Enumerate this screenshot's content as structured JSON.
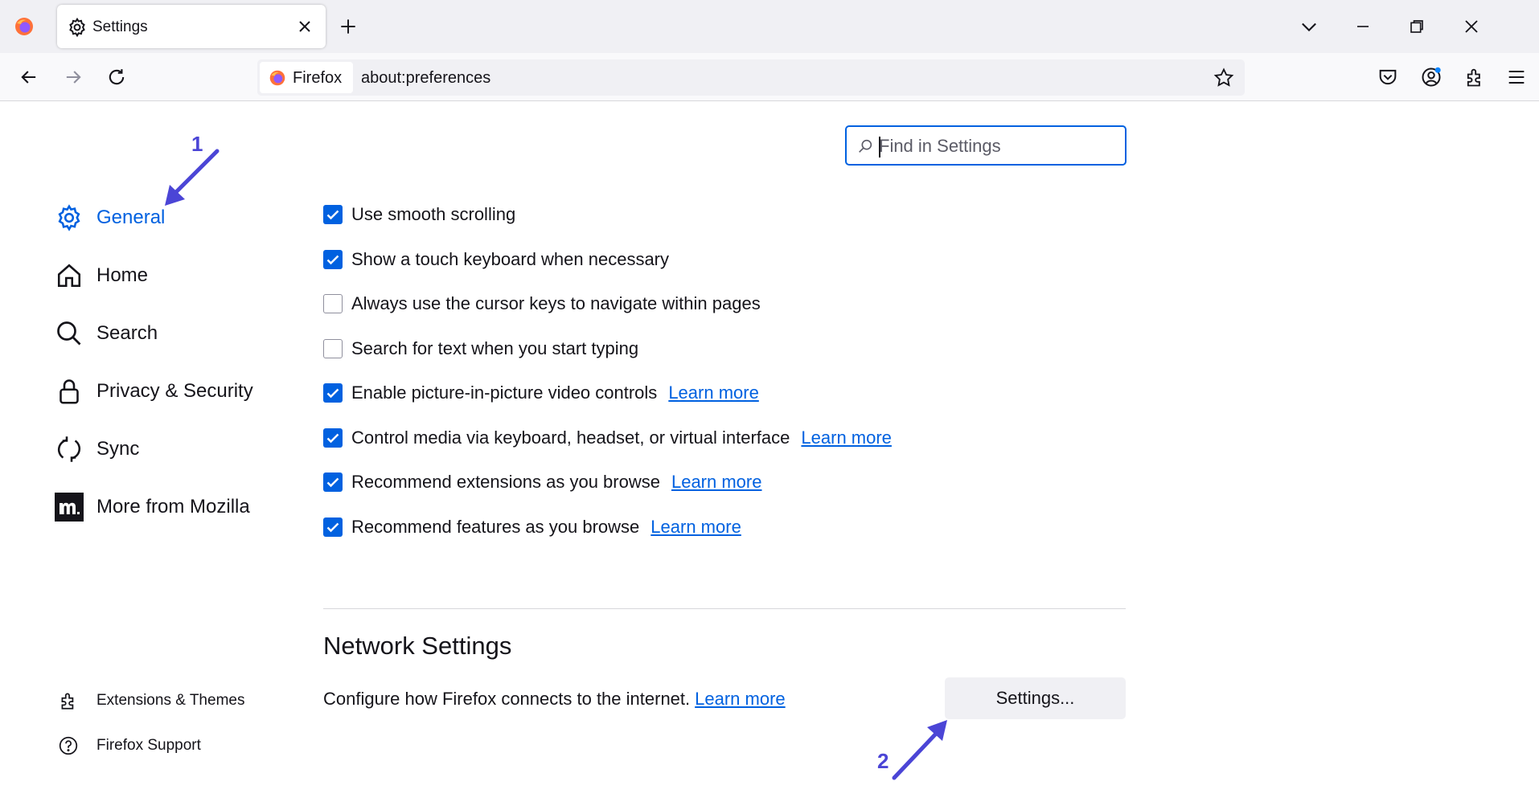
{
  "tab": {
    "title": "Settings"
  },
  "urlbar": {
    "identity_label": "Firefox",
    "url": "about:preferences"
  },
  "search": {
    "placeholder": "Find in Settings"
  },
  "sidebar": {
    "categories": [
      {
        "label": "General",
        "icon": "gear-icon",
        "selected": true
      },
      {
        "label": "Home",
        "icon": "home-icon"
      },
      {
        "label": "Search",
        "icon": "search-icon"
      },
      {
        "label": "Privacy & Security",
        "icon": "lock-icon"
      },
      {
        "label": "Sync",
        "icon": "sync-icon"
      },
      {
        "label": "More from Mozilla",
        "icon": "mozilla-m-icon"
      }
    ],
    "footer": [
      {
        "label": "Extensions & Themes",
        "icon": "puzzle-icon"
      },
      {
        "label": "Firefox Support",
        "icon": "help-icon"
      }
    ]
  },
  "options": [
    {
      "label": "Use smooth scrolling",
      "checked": true
    },
    {
      "label": "Show a touch keyboard when necessary",
      "checked": true
    },
    {
      "label": "Always use the cursor keys to navigate within pages",
      "checked": false
    },
    {
      "label": "Search for text when you start typing",
      "checked": false
    },
    {
      "label": "Enable picture-in-picture video controls",
      "checked": true,
      "link": "Learn more"
    },
    {
      "label": "Control media via keyboard, headset, or virtual interface",
      "checked": true,
      "link": "Learn more"
    },
    {
      "label": "Recommend extensions as you browse",
      "checked": true,
      "link": "Learn more"
    },
    {
      "label": "Recommend features as you browse",
      "checked": true,
      "link": "Learn more"
    }
  ],
  "network": {
    "title": "Network Settings",
    "description": "Configure how Firefox connects to the internet.",
    "link": "Learn more",
    "button": "Settings..."
  },
  "annotations": {
    "one": "1",
    "two": "2"
  },
  "colors": {
    "accent": "#0061e0",
    "annotation": "#4b45d6"
  }
}
